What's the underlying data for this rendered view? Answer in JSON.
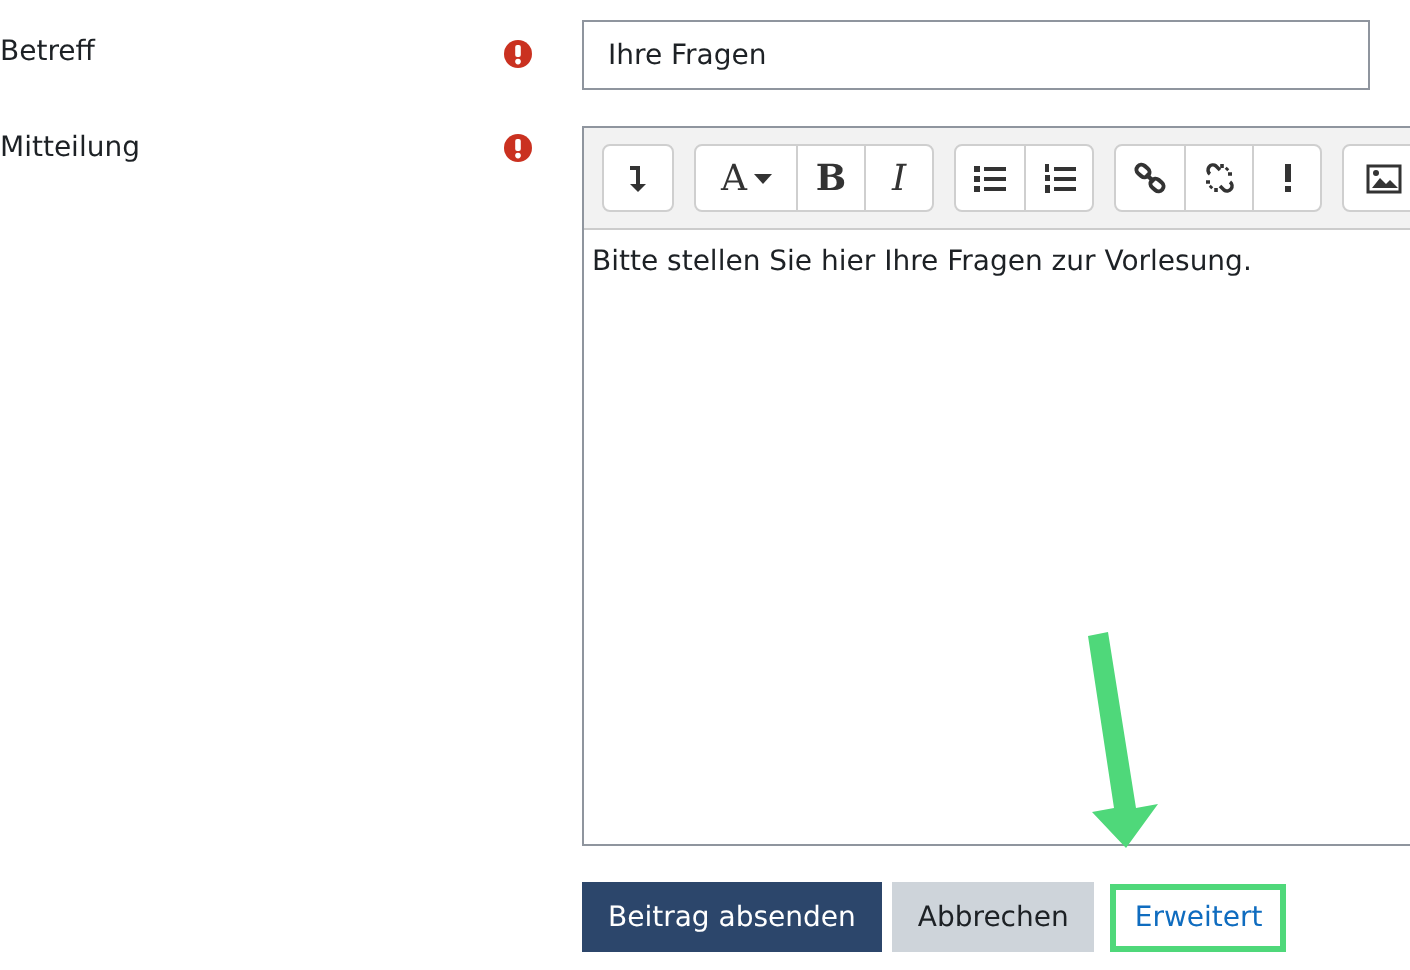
{
  "fields": [
    {
      "label": "Betreff",
      "required": true,
      "kind": "text",
      "value": "Ihre Fragen"
    },
    {
      "label": "Mitteilung",
      "required": true,
      "kind": "editor",
      "value": "Bitte stellen Sie hier Ihre Fragen zur Vorlesung.",
      "toolbar": [
        [
          {
            "kind": "collapse"
          }
        ],
        [
          {
            "kind": "font",
            "glyph": "A"
          },
          {
            "kind": "bold",
            "glyph": "B"
          },
          {
            "kind": "italic",
            "glyph": "I"
          }
        ],
        [
          {
            "kind": "bullets"
          },
          {
            "kind": "numbers"
          }
        ],
        [
          {
            "kind": "link"
          },
          {
            "kind": "unlink"
          },
          {
            "kind": "alert"
          }
        ],
        [
          {
            "kind": "image"
          }
        ]
      ]
    }
  ],
  "buttons": [
    {
      "label": "Beitrag absenden",
      "kind": "primary"
    },
    {
      "label": "Abbrechen",
      "kind": "secondary"
    },
    {
      "label": "Erweitert",
      "kind": "link",
      "highlighted": true
    }
  ]
}
